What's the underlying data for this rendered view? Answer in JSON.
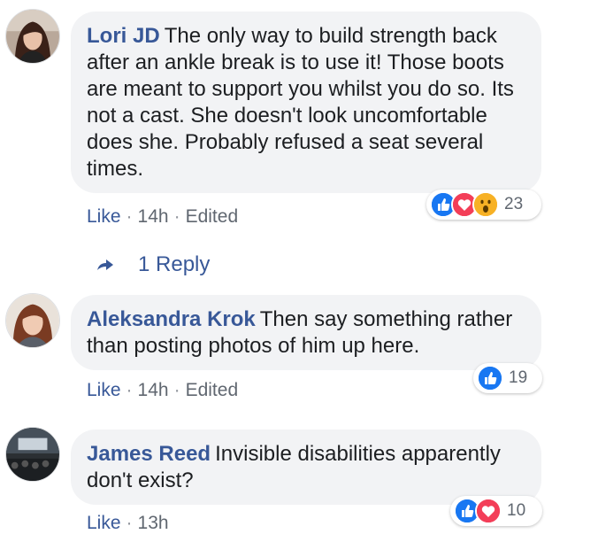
{
  "comments": [
    {
      "author": "Lori JD",
      "text": "The only way to build strength back after an ankle break is to use it! Those boots are meant to support you whilst you do so. Its not a cast. She doesn't look uncomfortable does she. Probably refused a seat several times.",
      "like_label": "Like",
      "time": "14h",
      "edited": "Edited",
      "reaction_count": "23",
      "reactions": [
        "like-icon",
        "love-icon",
        "wow-icon"
      ]
    },
    {
      "author": "Aleksandra Krok",
      "text": "Then say something rather than posting photos of him up here.",
      "like_label": "Like",
      "time": "14h",
      "edited": "Edited",
      "reaction_count": "19",
      "reactions": [
        "like-icon"
      ]
    },
    {
      "author": "James Reed",
      "text": "Invisible disabilities apparently don't exist?",
      "like_label": "Like",
      "time": "13h",
      "reaction_count": "10",
      "reactions": [
        "like-icon",
        "love-icon"
      ]
    }
  ],
  "reply": {
    "label": "1 Reply",
    "icon": "reply-arrow-icon"
  },
  "colors": {
    "link": "#385898",
    "bubble": "#f2f3f5",
    "meta": "#606770",
    "like": "#1877f2",
    "love": "#f33e58",
    "wow": "#f7b125"
  }
}
